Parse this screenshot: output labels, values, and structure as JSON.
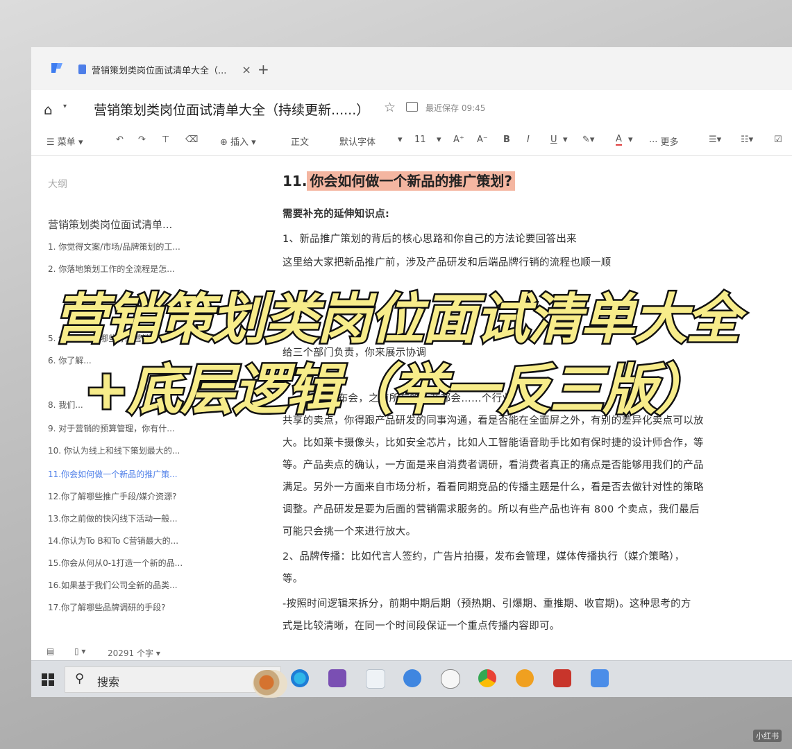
{
  "tabbar": {
    "tab_title": "营销策划类岗位面试清单大全（...",
    "close": "×",
    "add": "+"
  },
  "titlebar": {
    "doc_title": "营销策划类岗位面试清单大全（持续更新......）",
    "saved": "最近保存 09:45"
  },
  "toolbar": {
    "menu": "菜单",
    "insert": "插入",
    "style": "正文",
    "font": "默认字体",
    "size": "11",
    "bold": "B",
    "italic": "I",
    "underline": "U",
    "font_color": "A",
    "more": "更多"
  },
  "outline": {
    "title": "大纲",
    "doc": "营销策划类岗位面试清单...",
    "items": [
      {
        "label": "1. 你觉得文案/市场/品牌策划的工..."
      },
      {
        "label": "2. 你落地策划工作的全流程是怎..."
      },
      {
        "label": "5. 你以前做过哪些好的营销..."
      },
      {
        "label": "6. 你了解..."
      },
      {
        "label": "8. 我们..."
      },
      {
        "label": "9. 对于营销的预算管理，你有什..."
      },
      {
        "label": "10. 你认为线上和线下策划最大的..."
      },
      {
        "label": "11.你会如何做一个新品的推广策..."
      },
      {
        "label": "12.你了解哪些推广手段/媒介资源?"
      },
      {
        "label": "13.你之前做的快闪线下活动一般..."
      },
      {
        "label": "14.你认为To B和To C营销最大的..."
      },
      {
        "label": "15.你会从何从0-1打造一个新的品..."
      },
      {
        "label": "16.如果基于我们公司全新的品类..."
      },
      {
        "label": "17.你了解哪些品牌调研的手段?"
      }
    ]
  },
  "doc": {
    "heading_num": "11.",
    "heading": "你会如何做一个新品的推广策划?",
    "subheading": "需要补充的延伸知识点:",
    "lines": [
      "1、新品推广策划的背后的核心思路和你自己的方法论要回答出来",
      "这里给大家把新品推广前，涉及产品研发和后端品牌行销的流程也顺一顺",
      "给三个部门负责，你来展示协调",
      "机发布会，之前所有的厂商都会……个行业",
      "共享的卖点，你得跟产品研发的同事沟通，看是否能在全面屏之外，有别的差异化卖点可以放",
      "大。比如莱卡摄像头，比如安全芯片，比如人工智能语音助手比如有保时捷的设计师合作，等",
      "等。产品卖点的确认，一方面是来自消费者调研，看消费者真正的痛点是否能够用我们的产品",
      "满足。另外一方面来自市场分析，看看同期竞品的传播主题是什么，看是否去做针对性的策略",
      "调整。产品研发是要为后面的营销需求服务的。所以有些产品也许有 800 个卖点，我们最后",
      "可能只会挑一个来进行放大。",
      "2、品牌传播：比如代言人签约，广告片拍摄，发布会管理，媒体传播执行（媒介策略），",
      "等。",
      "-按照时间逻辑来拆分，前期中期后期（预热期、引爆期、重推期、收官期)。这种思考的方",
      "式是比较清晰，在同一个时间段保证一个重点传播内容即可。"
    ]
  },
  "statusbar": {
    "word_count": "20291 个字"
  },
  "taskbar": {
    "search": "搜索"
  },
  "overlay": {
    "line1": "营销策划类岗位面试清单大全",
    "line2": "+底层逻辑（举一反三版）"
  },
  "watermark": "小红书"
}
